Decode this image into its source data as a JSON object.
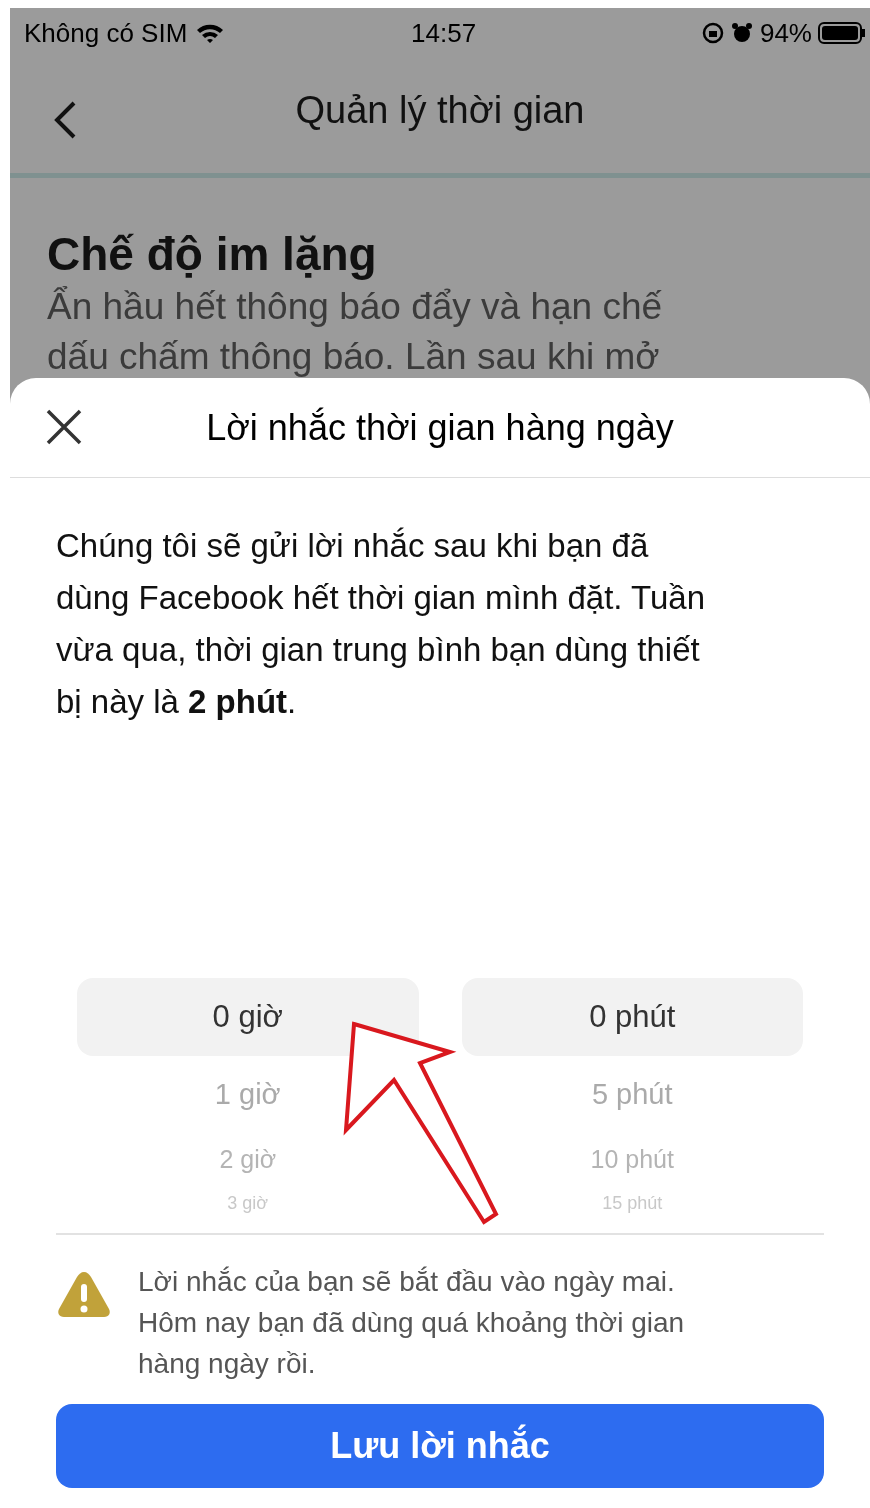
{
  "status_bar": {
    "carrier": "Không có SIM",
    "time": "14:57",
    "battery": "94%"
  },
  "nav": {
    "title": "Quản lý thời gian"
  },
  "background": {
    "heading": "Chế độ im lặng",
    "lines": [
      "Ẩn hầu hết thông báo đẩy và hạn chế",
      "dấu chấm thông báo. Lần sau khi mở"
    ]
  },
  "sheet": {
    "title": "Lời nhắc thời gian hàng ngày",
    "description": [
      "Chúng tôi sẽ gửi lời nhắc sau khi bạn đã",
      "dùng Facebook hết thời gian mình đặt. Tuần",
      "vừa qua, thời gian trung bình bạn dùng thiết",
      "bị này là **2 phút**."
    ],
    "pickers": [
      {
        "items": [
          {
            "label": "0 giờ",
            "selected": true
          },
          {
            "label": "1 giờ",
            "selected": false
          },
          {
            "label": "2 giờ",
            "selected": false
          },
          {
            "label": "3 giờ",
            "selected": false
          }
        ]
      },
      {
        "items": [
          {
            "label": "0 phút",
            "selected": true
          },
          {
            "label": "5 phút",
            "selected": false
          },
          {
            "label": "10 phút",
            "selected": false
          },
          {
            "label": "15 phút",
            "selected": false
          }
        ]
      }
    ],
    "warning": [
      "Lời nhắc của bạn sẽ bắt đầu vào ngày mai.",
      "Hôm nay bạn đã dùng quá khoảng thời gian",
      "hàng ngày rồi."
    ],
    "save_button": "Lưu lời nhắc"
  }
}
